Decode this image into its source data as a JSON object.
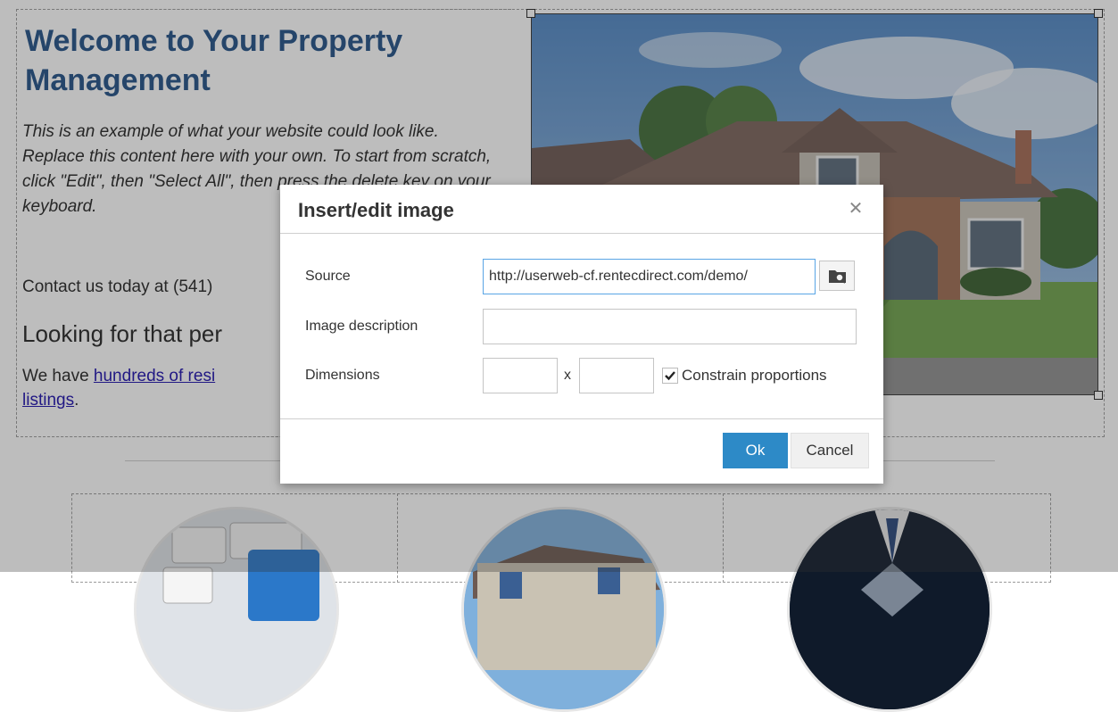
{
  "page": {
    "title": "Welcome to Your Property Management",
    "intro": "This is an example of what your website could look like. Replace this content here with your own. To start from scratch, click \"Edit\", then \"Select All\", then press the delete key on your keyboard.",
    "contact": "Contact us today at (541)",
    "looking": "Looking for that per",
    "have_prefix": "We have ",
    "have_link": "hundreds of resi",
    "have_link2": "listings",
    "have_suffix": "."
  },
  "dialog": {
    "title": "Insert/edit image",
    "close_icon": "close-icon",
    "source_label": "Source",
    "source_value": "http://userweb-cf.rentecdirect.com/demo/",
    "browse_icon": "browse-folder-icon",
    "description_label": "Image description",
    "description_value": "",
    "dimensions_label": "Dimensions",
    "width_value": "",
    "height_value": "",
    "times": "x",
    "constrain_label": "Constrain proportions",
    "constrain_checked": true,
    "ok_label": "Ok",
    "cancel_label": "Cancel"
  },
  "colors": {
    "title": "#1f4e85",
    "link": "#1a0dab",
    "ok_button": "#2d8ac7",
    "overlay": "rgba(50,50,50,0.32)"
  }
}
